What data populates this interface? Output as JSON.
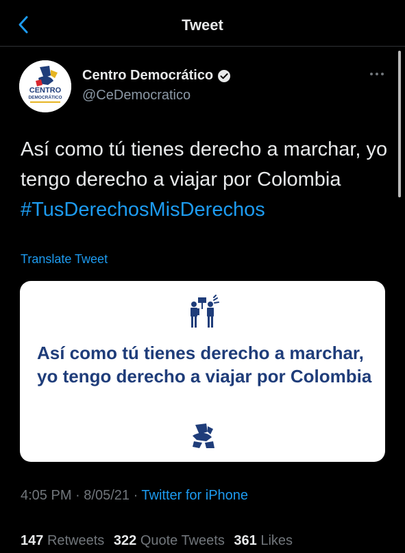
{
  "header": {
    "title": "Tweet",
    "back_icon": "chevron-left-icon"
  },
  "tweet": {
    "author_name": "Centro Democrático",
    "author_handle": "@CeDemocratico",
    "verified_icon": "verified-badge-icon",
    "avatar_text_top": "CENTRO",
    "avatar_text_bottom": "DEMOCRÁTICO",
    "text_before_hashtag": "Así como tú tienes derecho a marchar, yo tengo derecho a viajar por Colombia ",
    "hashtag": "#TusDerechosMisDerechos",
    "translate_label": "Translate Tweet",
    "card_text": "Así como tú tienes derecho a marchar, yo tengo derecho a viajar por Colombia",
    "time": "4:05 PM",
    "date": "8/05/21",
    "source": "Twitter for iPhone"
  },
  "stats": {
    "retweets_count": "147",
    "retweets_label": "Retweets",
    "quote_count": "322",
    "quote_label": "Quote Tweets",
    "likes_count": "361",
    "likes_label": "Likes"
  },
  "colors": {
    "background": "#000000",
    "link": "#1d9bf0",
    "card_text": "#1f3d7a",
    "muted": "#71767b"
  }
}
